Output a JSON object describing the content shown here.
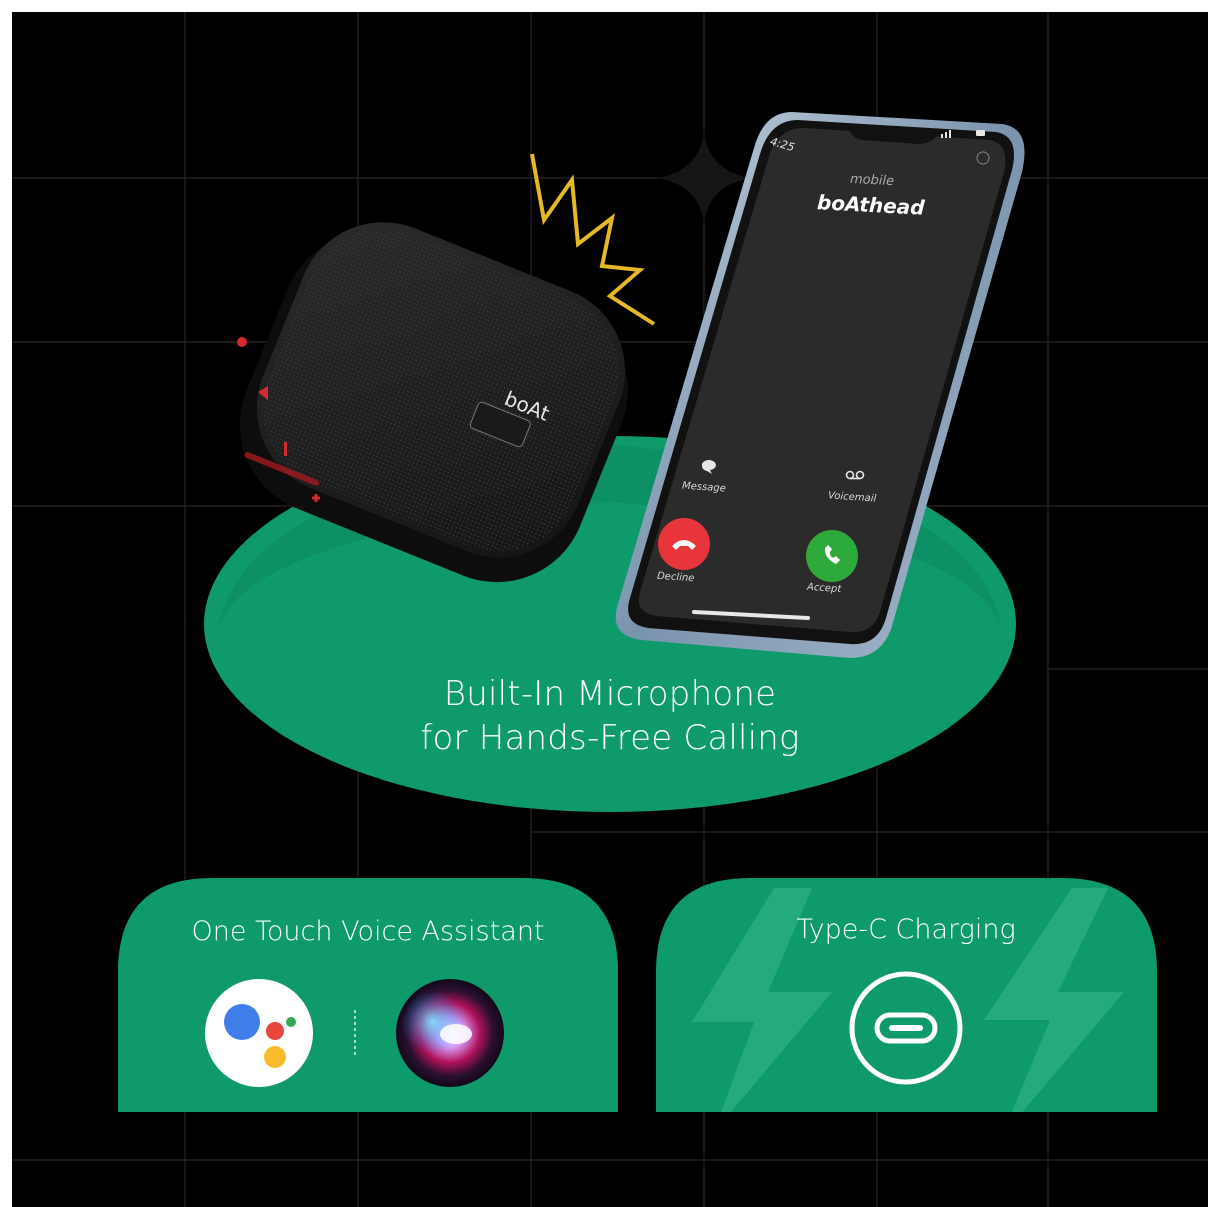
{
  "colors": {
    "background": "#000000",
    "accent_green": "#0f9a6c",
    "grid_line": "#262626",
    "zigzag": "#e5b825",
    "decline_red": "#e8343b",
    "accept_green": "#2ea93b"
  },
  "phone": {
    "time": "4:25",
    "call_label": "mobile",
    "caller_name": "boAthead",
    "message_label": "Message",
    "voicemail_label": "Voicemail",
    "decline_label": "Decline",
    "accept_label": "Accept"
  },
  "speaker": {
    "brand": "boAt"
  },
  "headline": {
    "line1": "Built-In Microphone",
    "line2": "for Hands-Free Calling"
  },
  "cards": {
    "voice_assistant": {
      "title": "One Touch Voice Assistant",
      "icons": [
        "google-assistant-icon",
        "siri-icon"
      ]
    },
    "charging": {
      "title": "Type-C Charging",
      "icons": [
        "usb-c-port-icon",
        "lightning-bolt-icon"
      ]
    }
  }
}
